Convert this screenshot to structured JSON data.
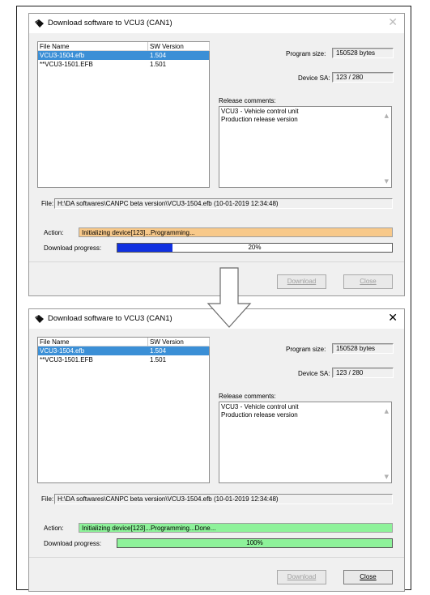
{
  "dialogs": [
    {
      "title": "Download software to VCU3 (CAN1)",
      "close_glyph": "✕",
      "columns": [
        "File Name",
        "SW Version"
      ],
      "files": [
        {
          "name": "VCU3-1504.efb",
          "version": "1.504",
          "selected": true
        },
        {
          "name": "**VCU3-1501.EFB",
          "version": "1.501",
          "selected": false
        }
      ],
      "program_size_label": "Program size:",
      "program_size": "150528 bytes",
      "device_sa_label": "Device SA:",
      "device_sa": "123 / 280",
      "release_comments_label": "Release comments:",
      "release_comments": [
        "VCU3 - Vehicle control unit",
        "Production release version"
      ],
      "file_label": "File:",
      "file_path": "H:\\DA softwares\\CANPC beta version\\VCU3-1504.efb (10-01-2019 12:34:48)",
      "action_label": "Action:",
      "action_text": "Initializing device[123]...Programming...",
      "action_color": "#f8c98a",
      "progress_label": "Download progress:",
      "progress_fraction": 0.2,
      "progress_text": "20%",
      "progress_color": "#1030e0",
      "download_label": "Download",
      "close_label": "Close"
    },
    {
      "title": "Download software to VCU3 (CAN1)",
      "close_glyph": "✕",
      "columns": [
        "File Name",
        "SW Version"
      ],
      "files": [
        {
          "name": "VCU3-1504.efb",
          "version": "1.504",
          "selected": true
        },
        {
          "name": "**VCU3-1501.EFB",
          "version": "1.501",
          "selected": false
        }
      ],
      "program_size_label": "Program size:",
      "program_size": "150528 bytes",
      "device_sa_label": "Device SA:",
      "device_sa": "123 / 280",
      "release_comments_label": "Release comments:",
      "release_comments": [
        "VCU3 - Vehicle control unit",
        "Production release version"
      ],
      "file_label": "File:",
      "file_path": "H:\\DA softwares\\CANPC beta version\\VCU3-1504.efb (10-01-2019 12:34:48)",
      "action_label": "Action:",
      "action_text": "Initializing device[123]...Programming...Done...",
      "action_color": "#8ef29a",
      "progress_label": "Download progress:",
      "progress_fraction": 1.0,
      "progress_text": "100%",
      "progress_color": "#8ef29a",
      "download_label": "Download",
      "close_label": "Close"
    }
  ],
  "icons": {
    "title": "app-icon",
    "arrow": "down-arrow-icon"
  }
}
